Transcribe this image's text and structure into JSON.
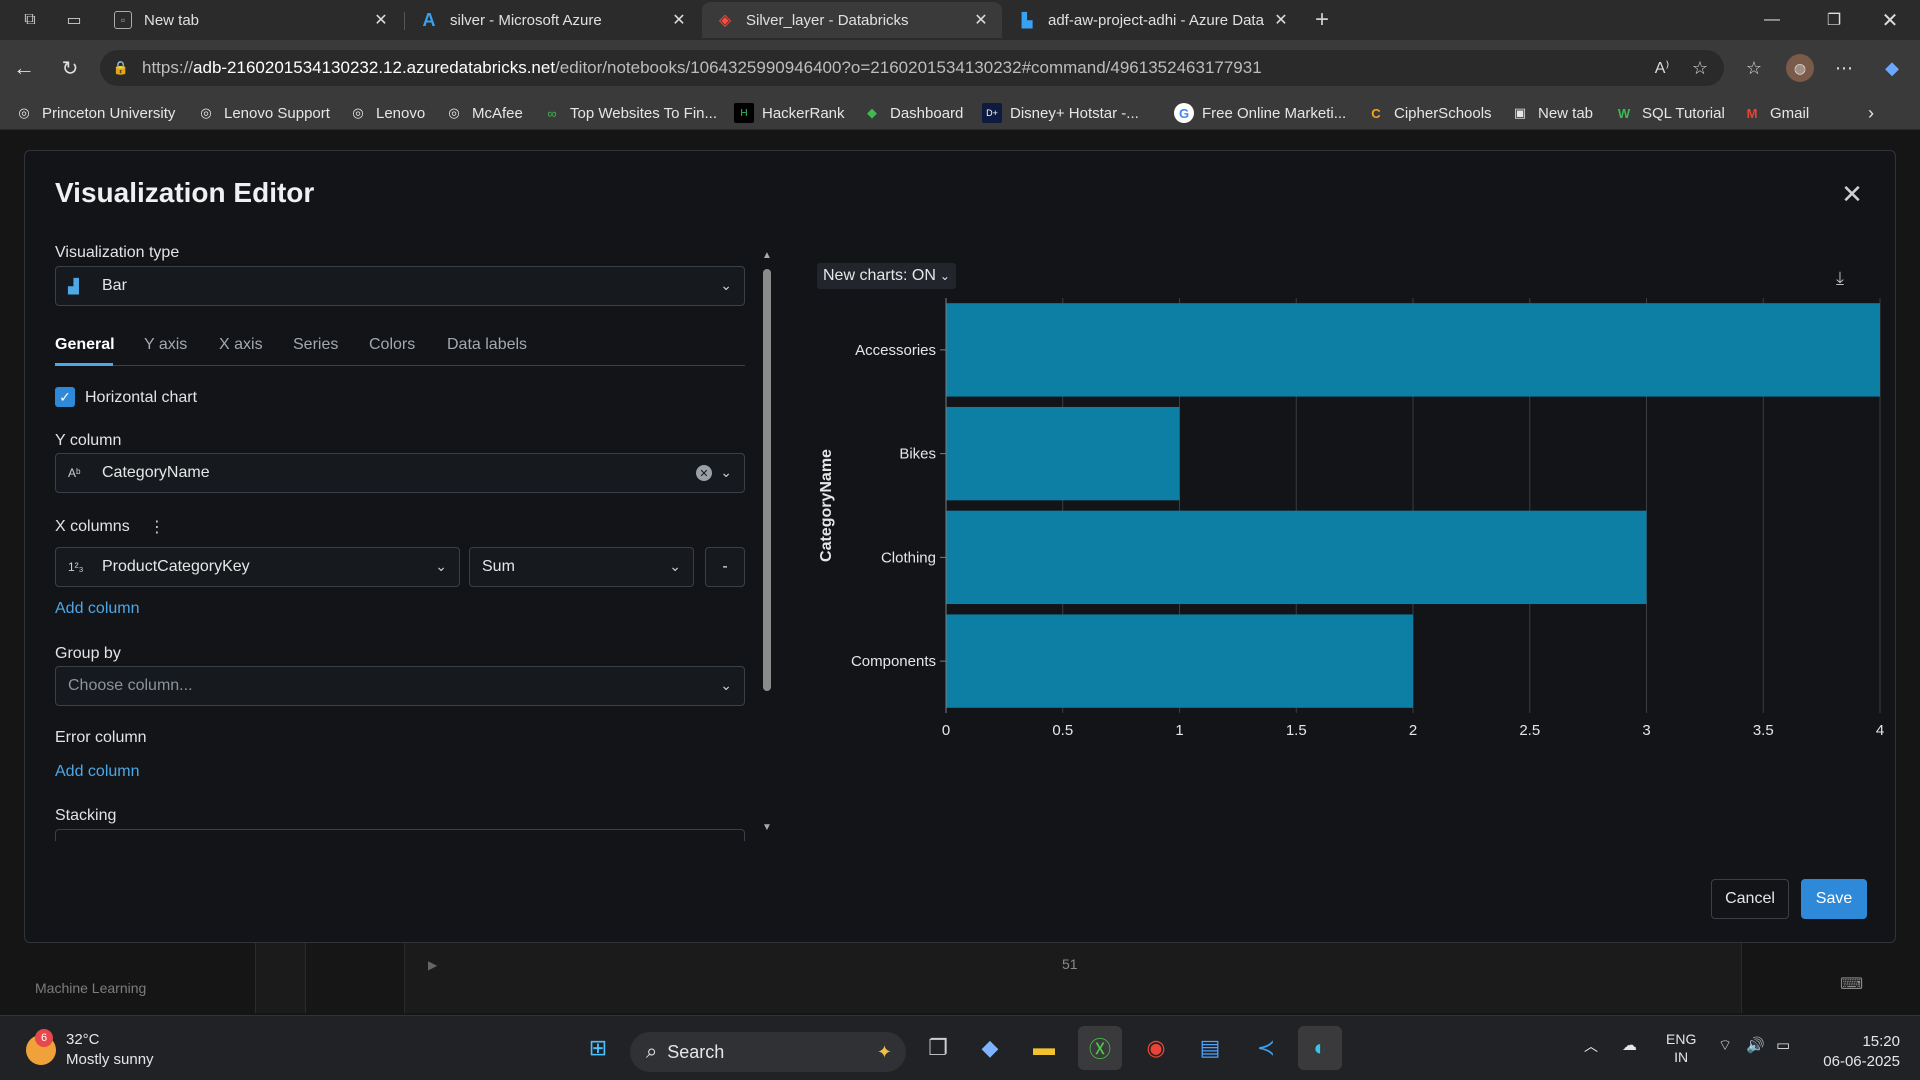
{
  "browser": {
    "tabs": [
      {
        "title": "New tab",
        "favicon": "newtab-icon",
        "active": false
      },
      {
        "title": "silver - Microsoft Azure",
        "favicon": "azure-icon",
        "active": false
      },
      {
        "title": "Silver_layer - Databricks",
        "favicon": "databricks-icon",
        "active": true
      },
      {
        "title": "adf-aw-project-adhi - Azure Data",
        "favicon": "datafactory-icon",
        "active": false
      }
    ],
    "url_prefix": "https://",
    "url_host": "adb-2160201534130232.12.azuredatabricks.net",
    "url_path": "/editor/notebooks/1064325990946400?o=2160201534130232#command/4961352463177931",
    "bookmarks": [
      "Princeton University",
      "Lenovo Support",
      "Lenovo",
      "McAfee",
      "Top Websites To Fin...",
      "HackerRank",
      "Dashboard",
      "Disney+ Hotstar -...",
      "Free Online Marketi...",
      "CipherSchools",
      "New tab",
      "SQL Tutorial",
      "Gmail"
    ]
  },
  "background": {
    "sidebar_label": "Machine Learning",
    "cell_number": "51"
  },
  "editor": {
    "title": "Visualization Editor",
    "visualization_type_label": "Visualization type",
    "visualization_type_value": "Bar",
    "tabs": [
      "General",
      "Y axis",
      "X axis",
      "Series",
      "Colors",
      "Data labels"
    ],
    "active_tab": "General",
    "horizontal_chart_label": "Horizontal chart",
    "horizontal_chart_checked": true,
    "y_column_label": "Y column",
    "y_column_value": "CategoryName",
    "x_columns_label": "X columns",
    "x_column_value": "ProductCategoryKey",
    "x_aggregation_value": "Sum",
    "remove_label": "-",
    "add_column_label": "Add column",
    "group_by_label": "Group by",
    "group_by_placeholder": "Choose column...",
    "error_column_label": "Error column",
    "error_add_column_label": "Add column",
    "stacking_label": "Stacking",
    "new_charts_toggle": "New charts: ON",
    "cancel_label": "Cancel",
    "save_label": "Save",
    "accent_color": "#2e8ad8",
    "bar_color": "#0d7fa5"
  },
  "chart_data": {
    "type": "bar",
    "orientation": "horizontal",
    "categories": [
      "Accessories",
      "Bikes",
      "Clothing",
      "Components"
    ],
    "values": [
      4,
      1,
      3,
      2
    ],
    "xlabel": "ProductCategoryKey",
    "ylabel": "CategoryName",
    "xlim": [
      0,
      4
    ],
    "xticks": [
      "0",
      "0.5",
      "1",
      "1.5",
      "2",
      "2.5",
      "3",
      "3.5",
      "4"
    ],
    "grid": true
  },
  "taskbar": {
    "temperature": "32°C",
    "weather": "Mostly sunny",
    "weather_badge": "6",
    "search_label": "Search",
    "language": "ENG",
    "region": "IN",
    "time": "15:20",
    "date": "06-06-2025"
  }
}
